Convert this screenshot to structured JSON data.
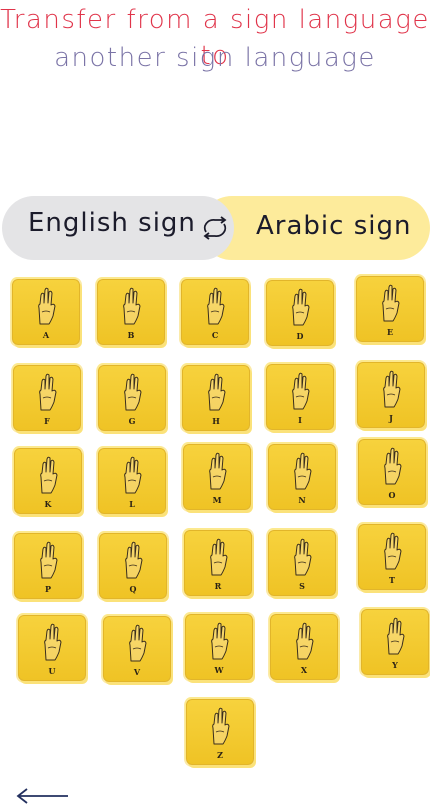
{
  "header": {
    "title_line1": "Transfer from a sign language to",
    "title_line2": "another sign language"
  },
  "toggle": {
    "left_label": "English sign",
    "right_label": "Arabic sign",
    "swap_icon": "swap-arrows-icon"
  },
  "letters": [
    "A",
    "B",
    "C",
    "D",
    "E",
    "F",
    "G",
    "H",
    "I",
    "J",
    "K",
    "L",
    "M",
    "N",
    "O",
    "P",
    "Q",
    "R",
    "S",
    "T",
    "U",
    "V",
    "W",
    "X",
    "Y",
    "Z"
  ],
  "colors": {
    "title_primary": "#e0344a",
    "title_secondary": "#7a73a6",
    "card": "#f3c92f",
    "toggle_left_bg": "#e4e4e6",
    "toggle_right_bg": "#fdeb9b"
  },
  "navigation": {
    "back_icon": "arrow-left-icon"
  }
}
